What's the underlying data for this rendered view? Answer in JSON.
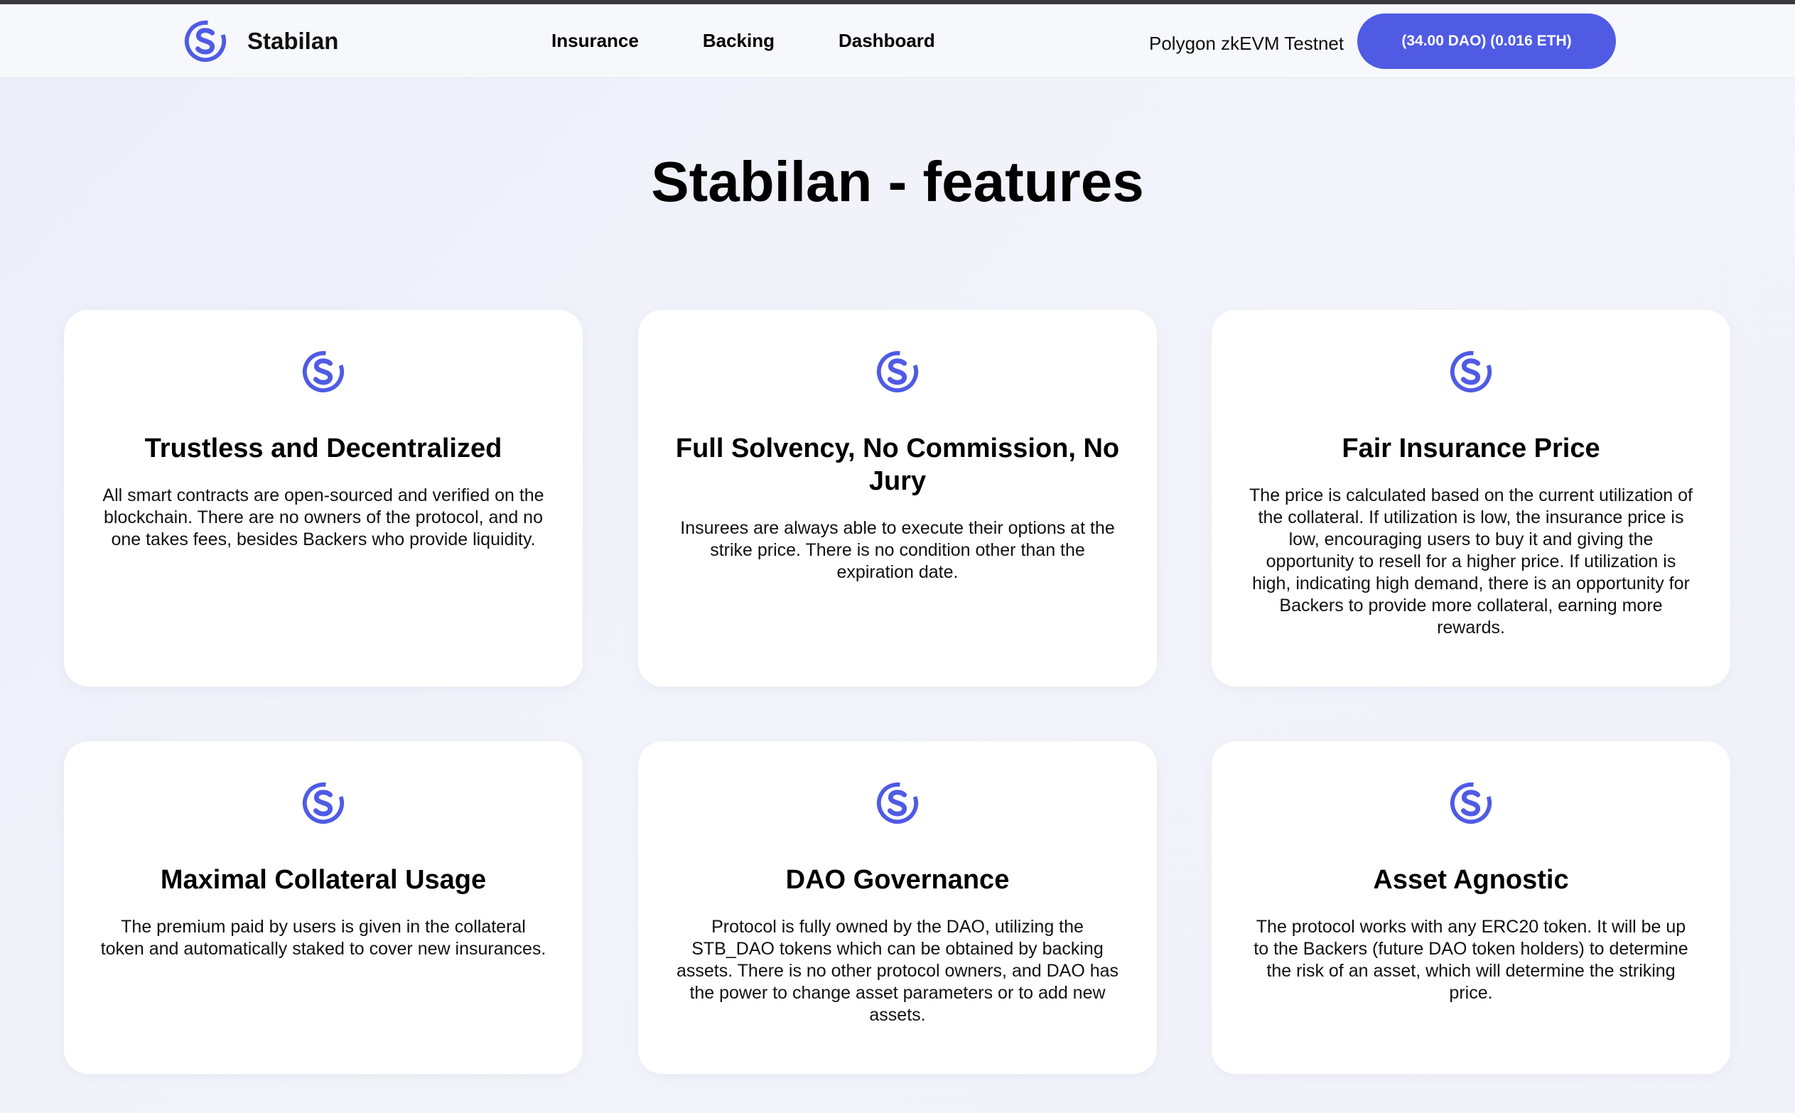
{
  "header": {
    "brand_name": "Stabilan",
    "nav": [
      "Insurance",
      "Backing",
      "Dashboard"
    ],
    "network": "Polygon zkEVM Testnet",
    "wallet_button": "(34.00 DAO) (0.016 ETH)"
  },
  "page_title": "Stabilan - features",
  "features": [
    {
      "title": "Trustless and Decentralized",
      "text": "All smart contracts are open-sourced and verified on the blockchain. There are no owners of the protocol, and no one takes fees, besides Backers who provide liquidity."
    },
    {
      "title": "Full Solvency, No Commission, No Jury",
      "text": "Insurees are always able to execute their options at the strike price. There is no condition other than the expiration date."
    },
    {
      "title": "Fair Insurance Price",
      "text": "The price is calculated based on the current utilization of the collateral. If utilization is low, the insurance price is low, encouraging users to buy it and giving the opportunity to resell for a higher price. If utilization is high, indicating high demand, there is an opportunity for Backers to provide more collateral, earning more rewards."
    },
    {
      "title": "Maximal Collateral Usage",
      "text": "The premium paid by users is given in the collateral token and automatically staked to cover new insurances."
    },
    {
      "title": "DAO Governance",
      "text": "Protocol is fully owned by the DAO, utilizing the STB_DAO tokens which can be obtained by backing assets. There is no other protocol owners, and DAO has the power to change asset parameters or to add new assets."
    },
    {
      "title": "Asset Agnostic",
      "text": "The protocol works with any ERC20 token. It will be up to the Backers (future DAO token holders) to determine the risk of an asset, which will determine the striking price."
    }
  ],
  "colors": {
    "accent": "#4f5be3",
    "background": "#eef0f9",
    "card": "#ffffff"
  },
  "icons": {
    "logo": "stabilan-s-logo-icon"
  }
}
